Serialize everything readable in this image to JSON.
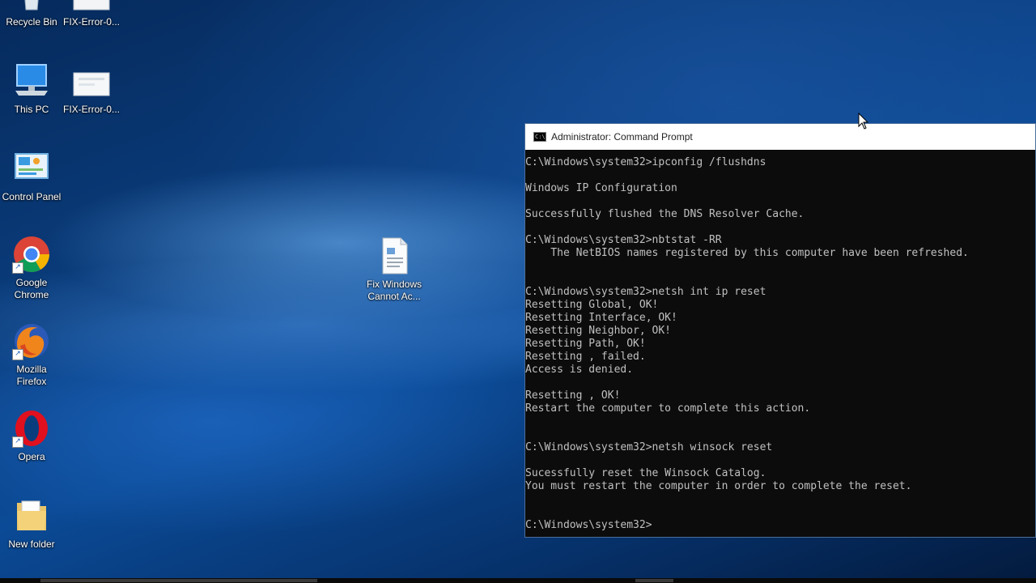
{
  "desktop": {
    "icons": [
      {
        "label": "Recycle Bin"
      },
      {
        "label": "FIX-Error-0..."
      },
      {
        "label": "This PC"
      },
      {
        "label": "FIX-Error-0..."
      },
      {
        "label": "Control Panel"
      },
      {
        "label": "Google Chrome"
      },
      {
        "label": "Fix Windows Cannot Ac..."
      },
      {
        "label": "Mozilla Firefox"
      },
      {
        "label": "Opera"
      },
      {
        "label": "New folder"
      }
    ]
  },
  "cmd": {
    "title": "Administrator: Command Prompt",
    "icon_text": "C:\\",
    "lines": [
      "C:\\Windows\\system32>ipconfig /flushdns",
      "",
      "Windows IP Configuration",
      "",
      "Successfully flushed the DNS Resolver Cache.",
      "",
      "C:\\Windows\\system32>nbtstat -RR",
      "    The NetBIOS names registered by this computer have been refreshed.",
      "",
      "",
      "C:\\Windows\\system32>netsh int ip reset",
      "Resetting Global, OK!",
      "Resetting Interface, OK!",
      "Resetting Neighbor, OK!",
      "Resetting Path, OK!",
      "Resetting , failed.",
      "Access is denied.",
      "",
      "Resetting , OK!",
      "Restart the computer to complete this action.",
      "",
      "",
      "C:\\Windows\\system32>netsh winsock reset",
      "",
      "Sucessfully reset the Winsock Catalog.",
      "You must restart the computer in order to complete the reset.",
      "",
      "",
      "C:\\Windows\\system32>"
    ]
  },
  "colors": {
    "console_bg": "#0c0c0c",
    "console_text": "#c0c0c0",
    "titlebar_bg": "#ffffff"
  }
}
